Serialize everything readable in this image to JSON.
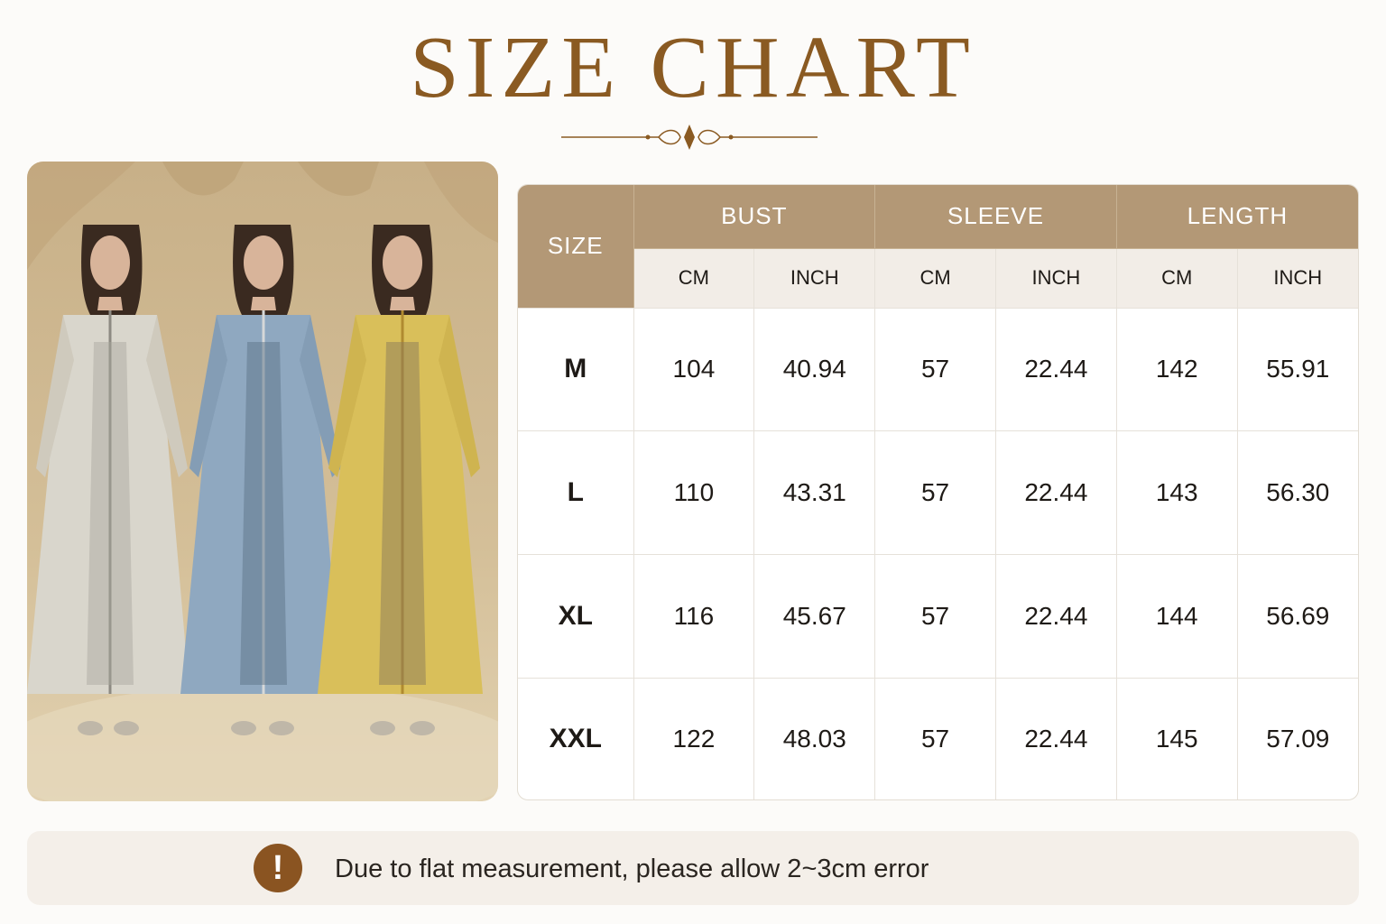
{
  "title": "SIZE CHART",
  "colors": {
    "title": "#8a5a22",
    "header_band": "#b39876",
    "unit_row": "#f2ede7",
    "notice_bg": "#f4efe9",
    "notice_icon": "#8a5421"
  },
  "table": {
    "size_header": "SIZE",
    "groups": [
      "BUST",
      "SLEEVE",
      "LENGTH"
    ],
    "units": [
      "CM",
      "INCH",
      "CM",
      "INCH",
      "CM",
      "INCH"
    ],
    "rows": [
      {
        "size": "M",
        "values": [
          "104",
          "40.94",
          "57",
          "22.44",
          "142",
          "55.91"
        ]
      },
      {
        "size": "L",
        "values": [
          "110",
          "43.31",
          "57",
          "22.44",
          "143",
          "56.30"
        ]
      },
      {
        "size": "XL",
        "values": [
          "116",
          "45.67",
          "57",
          "22.44",
          "144",
          "56.69"
        ]
      },
      {
        "size": "XXL",
        "values": [
          "122",
          "48.03",
          "57",
          "22.44",
          "145",
          "57.09"
        ]
      }
    ]
  },
  "notice": {
    "icon": "exclamation-icon",
    "icon_glyph": "!",
    "text": "Due to flat measurement, please allow 2~3cm error"
  },
  "photo": {
    "icon": "three-models-in-abayas-photo",
    "dress_colors": [
      "#d9d6cc",
      "#8fa8c0",
      "#d9bf5a"
    ]
  }
}
